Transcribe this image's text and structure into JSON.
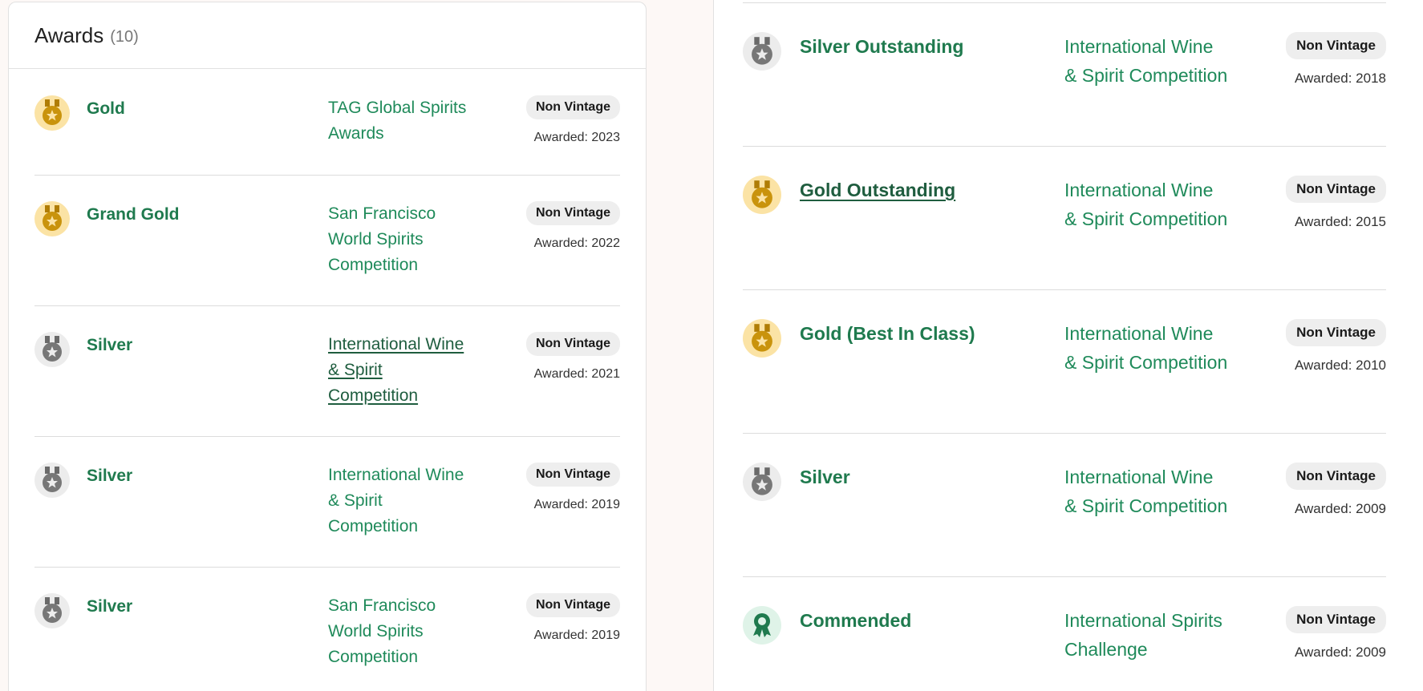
{
  "left_panel": {
    "title": "Awards",
    "count": "(10)",
    "awards": [
      {
        "medal": "gold-medal-icon",
        "name": "Gold",
        "competition": "TAG Global Spirits Awards",
        "vintage": "Non Vintage",
        "awarded": "Awarded: 2023"
      },
      {
        "medal": "gold-medal-icon",
        "name": "Grand Gold",
        "competition": "San Francisco World Spirits Competition",
        "vintage": "Non Vintage",
        "awarded": "Awarded: 2022"
      },
      {
        "medal": "silver-medal-icon",
        "name": "Silver",
        "competition": "International Wine & Spirit Competition",
        "vintage": "Non Vintage",
        "awarded": "Awarded: 2021"
      },
      {
        "medal": "silver-medal-icon",
        "name": "Silver",
        "competition": "International Wine & Spirit Competition",
        "vintage": "Non Vintage",
        "awarded": "Awarded: 2019"
      },
      {
        "medal": "silver-medal-icon",
        "name": "Silver",
        "competition": "San Francisco World Spirits Competition",
        "vintage": "Non Vintage",
        "awarded": "Awarded: 2019"
      }
    ]
  },
  "right_panel": {
    "awards": [
      {
        "medal": "silver-medal-icon",
        "name": "Silver Outstanding",
        "competition": "International Wine & Spirit Competition",
        "vintage": "Non Vintage",
        "awarded": "Awarded: 2018"
      },
      {
        "medal": "gold-medal-icon",
        "name": "Gold Outstanding",
        "competition": "International Wine & Spirit Competition",
        "vintage": "Non Vintage",
        "awarded": "Awarded: 2015"
      },
      {
        "medal": "gold-medal-icon",
        "name": "Gold (Best In Class)",
        "competition": "International Wine & Spirit Competition",
        "vintage": "Non Vintage",
        "awarded": "Awarded: 2010"
      },
      {
        "medal": "silver-medal-icon",
        "name": "Silver",
        "competition": "International Wine & Spirit Competition",
        "vintage": "Non Vintage",
        "awarded": "Awarded: 2009"
      },
      {
        "medal": "commended-rosette-icon",
        "name": "Commended",
        "competition": "International Spirits Challenge",
        "vintage": "Non Vintage",
        "awarded": "Awarded: 2009"
      }
    ]
  },
  "colors": {
    "link_green": "#1f8a5a",
    "name_green": "#1f7a4e",
    "gold_medal": "#c9930c",
    "silver_medal": "#777777",
    "commended": "#1f7a4e"
  }
}
